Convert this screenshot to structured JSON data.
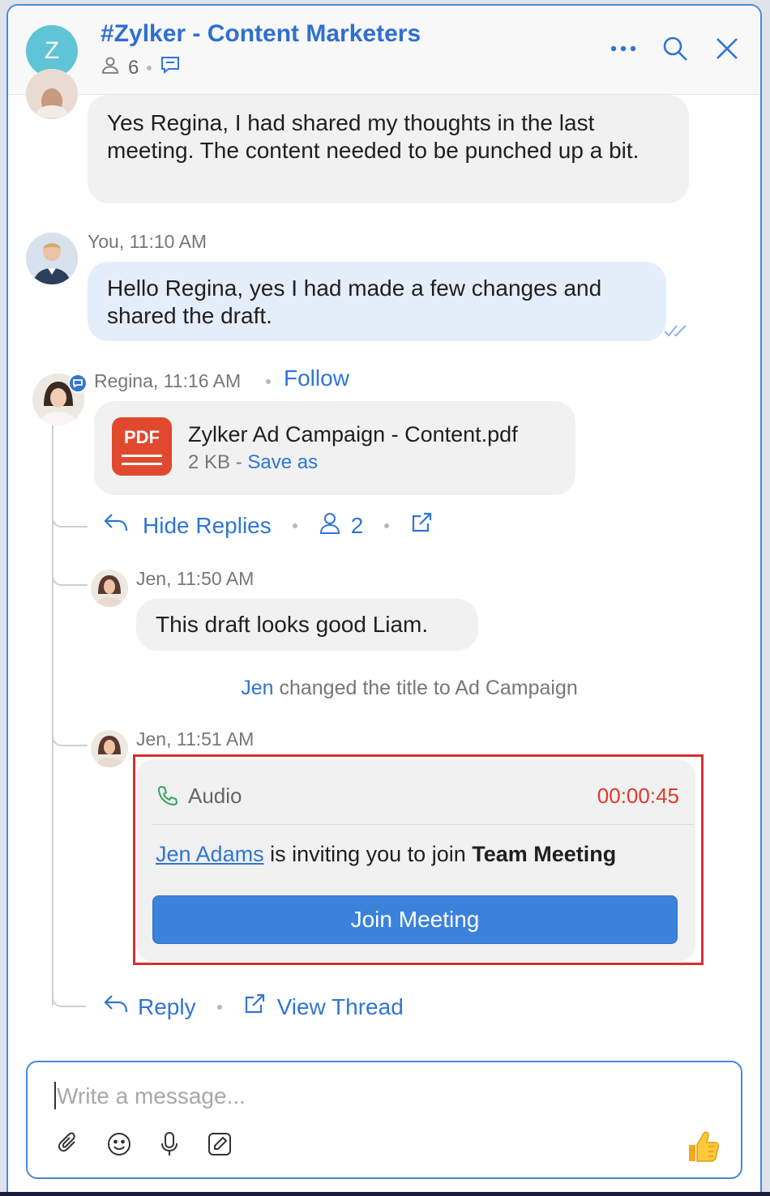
{
  "header": {
    "avatar_letter": "Z",
    "title": "#Zylker - Content Marketers",
    "member_count": "6"
  },
  "messages": {
    "m1": {
      "text": "Yes Regina, I had shared my thoughts in the last meeting. The content needed to be punched up a bit."
    },
    "m2": {
      "meta": "You, 11:10 AM",
      "text": "Hello Regina, yes I had made a few changes and shared the draft."
    },
    "m3": {
      "meta": "Regina, 11:16 AM",
      "follow_label": "Follow",
      "file_name": "Zylker Ad Campaign - Content.pdf",
      "file_size": "2 KB -",
      "save_as_label": "Save as",
      "pdf_badge": "PDF"
    },
    "thread_actions": {
      "hide_replies_label": "Hide Replies",
      "participants": "2"
    },
    "r1": {
      "meta": "Jen, 11:50 AM",
      "text": "This draft looks good Liam."
    },
    "system": {
      "actor": "Jen",
      "text": "changed the title to Ad Campaign"
    },
    "r2": {
      "meta": "Jen, 11:51 AM",
      "call_type": "Audio",
      "duration": "00:00:45",
      "inviter": "Jen Adams",
      "invite_text": "is inviting you to join",
      "meeting_name": "Team Meeting",
      "join_label": "Join Meeting"
    },
    "bottom_actions": {
      "reply_label": "Reply",
      "view_thread_label": "View Thread"
    }
  },
  "composer": {
    "placeholder": "Write a message..."
  },
  "colors": {
    "accent": "#2f75d6",
    "timer": "#e03a2f",
    "highlight_border": "#d92f2f",
    "pdf": "#e0492e",
    "phone": "#3aa35a"
  }
}
